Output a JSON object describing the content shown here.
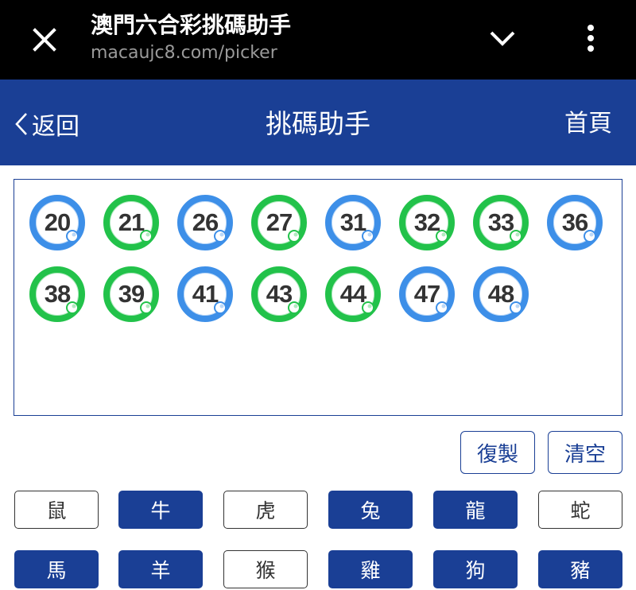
{
  "browser": {
    "title": "澳門六合彩挑碼助手",
    "url": "macaujc8.com/picker"
  },
  "header": {
    "back_label": "返回",
    "title": "挑碼助手",
    "home_label": "首頁",
    "color": "#1a3f95"
  },
  "balls": [
    {
      "number": "20",
      "color": "blue"
    },
    {
      "number": "21",
      "color": "green"
    },
    {
      "number": "26",
      "color": "blue"
    },
    {
      "number": "27",
      "color": "green"
    },
    {
      "number": "31",
      "color": "blue"
    },
    {
      "number": "32",
      "color": "green"
    },
    {
      "number": "33",
      "color": "green"
    },
    {
      "number": "36",
      "color": "blue"
    },
    {
      "number": "38",
      "color": "green"
    },
    {
      "number": "39",
      "color": "green"
    },
    {
      "number": "41",
      "color": "blue"
    },
    {
      "number": "43",
      "color": "green"
    },
    {
      "number": "44",
      "color": "green"
    },
    {
      "number": "47",
      "color": "blue"
    },
    {
      "number": "48",
      "color": "blue"
    }
  ],
  "ball_colors": {
    "blue": "#3d8fe8",
    "green": "#22c24a"
  },
  "actions": {
    "copy_label": "復製",
    "clear_label": "清空"
  },
  "zodiac": [
    {
      "label": "鼠",
      "style": "outline"
    },
    {
      "label": "牛",
      "style": "filled"
    },
    {
      "label": "虎",
      "style": "outline"
    },
    {
      "label": "兔",
      "style": "filled"
    },
    {
      "label": "龍",
      "style": "filled"
    },
    {
      "label": "蛇",
      "style": "outline"
    },
    {
      "label": "馬",
      "style": "filled"
    },
    {
      "label": "羊",
      "style": "filled"
    },
    {
      "label": "猴",
      "style": "outline"
    },
    {
      "label": "雞",
      "style": "filled"
    },
    {
      "label": "狗",
      "style": "filled"
    },
    {
      "label": "豬",
      "style": "filled"
    }
  ]
}
